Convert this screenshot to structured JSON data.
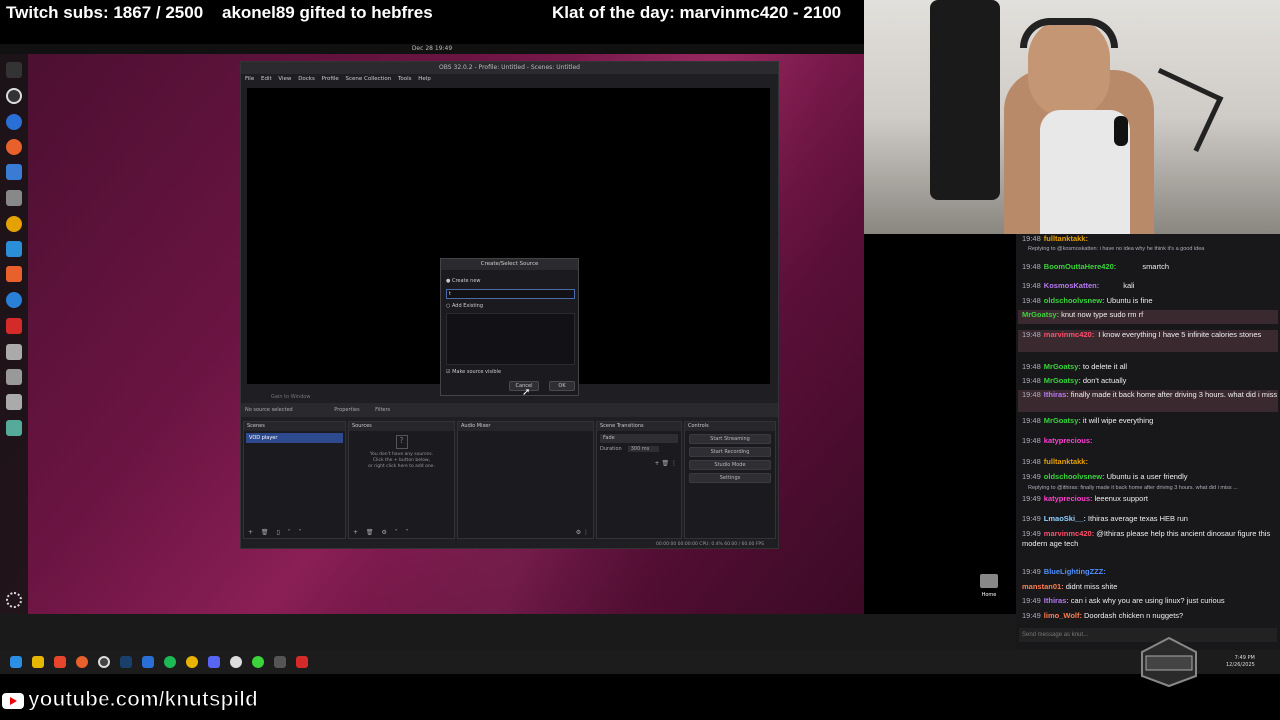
{
  "banner": {
    "subs": "Twitch subs: 1867 / 2500",
    "gift": "akonel89 gifted to hebfres",
    "klat": "Klat of the day: marvinmc420 - 2100"
  },
  "desktop": {
    "topbar_clock": "Dec 28  19:49",
    "home_label": "Home"
  },
  "obs": {
    "title": "OBS 32.0.2 - Profile: Untitled - Scenes: Untitled",
    "menu": [
      "File",
      "Edit",
      "View",
      "Docks",
      "Profile",
      "Scene Collection",
      "Tools",
      "Help"
    ],
    "no_source": "No source selected",
    "properties": "Properties",
    "filters": "Filters",
    "ctrl_strip": "Gain to Window",
    "docks": {
      "scenes": "Scenes",
      "sources": "Sources",
      "audio": "Audio Mixer",
      "transitions": "Scene Transitions",
      "controls": "Controls"
    },
    "scene_item": "VOD player",
    "no_sources_text": [
      "You don't have any sources.",
      "Click the + button below,",
      "or right click here to add one."
    ],
    "transition_value": "Fade",
    "duration_label": "Duration",
    "duration_value": "300 ms",
    "controls_buttons": [
      "Start Streaming",
      "Start Recording",
      "Studio Mode",
      "Settings"
    ],
    "status": "00:00:00     00:00:00     CPU: 0.4%    60.00 / 60.00 FPS"
  },
  "dialog": {
    "title": "Create/Select Source",
    "create_new": "Create new",
    "input_value": "t",
    "add_existing": "Add Existing",
    "make_visible": "Make source visible",
    "cancel": "Cancel",
    "ok": "OK"
  },
  "chat": {
    "messages": [
      {
        "time": "19:48",
        "user": "fulltanktakk:",
        "color": "#e5a100",
        "text": ""
      },
      {
        "time": "19:48",
        "user": "BoomOuttaHere420:",
        "color": "#3bd43b",
        "text": "smartch"
      },
      {
        "time": "19:48",
        "user": "KosmosKatten:",
        "color": "#b77bf0",
        "text": "kali"
      },
      {
        "time": "19:48",
        "user": "oldschoolvsnew:",
        "color": "#3bd43b",
        "text": "Ubuntu is fine"
      },
      {
        "time": "",
        "user": "MrGoatsy:",
        "color": "#3bd43b",
        "text": "knut now type sudo rm rf"
      },
      {
        "time": "19:48",
        "user": "marvinmc420:",
        "color": "#ff4f6a",
        "text": "I know everything I have 5 infinite calories stones"
      },
      {
        "time": "19:48",
        "user": "MrGoatsy:",
        "color": "#3bd43b",
        "text": "to delete it all"
      },
      {
        "time": "19:48",
        "user": "MrGoatsy:",
        "color": "#3bd43b",
        "text": "don't actually"
      },
      {
        "time": "19:48",
        "user": "Ithiras:",
        "color": "#b77bf0",
        "text": "finally made it back home after driving 3 hours. what did i miss"
      },
      {
        "time": "19:48",
        "user": "MrGoatsy:",
        "color": "#3bd43b",
        "text": "it will wipe everything"
      },
      {
        "time": "19:48",
        "user": "katyprecious:",
        "color": "#ff3fd0",
        "text": ""
      },
      {
        "time": "19:48",
        "user": "fulltanktakk:",
        "color": "#e5a100",
        "text": ""
      },
      {
        "time": "19:49",
        "user": "oldschoolvsnew:",
        "color": "#3bd43b",
        "text": "Ubuntu is a user friendly"
      },
      {
        "time": "19:49",
        "user": "katyprecious:",
        "color": "#ff3fd0",
        "text": "leeenux support"
      },
      {
        "time": "19:49",
        "user": "LmaoSki__:",
        "color": "#8fd0ff",
        "text": "Ithiras average texas HEB run"
      },
      {
        "time": "19:49",
        "user": "marvinmc420:",
        "color": "#ff4f6a",
        "text": "@Ithiras please help this ancient dinosaur figure this modern age tech"
      },
      {
        "time": "19:49",
        "user": "BlueLightingZZZ:",
        "color": "#4f8fff",
        "text": ""
      },
      {
        "time": "",
        "user": "manstan01:",
        "color": "#ff7f50",
        "text": "didnt miss shite"
      },
      {
        "time": "19:49",
        "user": "Ithiras:",
        "color": "#b77bf0",
        "text": "can i ask why you are using linux? just curious"
      },
      {
        "time": "19:49",
        "user": "limo_Wolf:",
        "color": "#ff7f50",
        "text": "Doordash chicken n nuggets?"
      }
    ],
    "reply1": "Replying to @kosmoskatten: i have no idea why he think it's a good idea",
    "reply2": "Replying to @ithiras: finally made it back home after driving 3 hours.  what did i miss ...",
    "input_placeholder": "Send message as knut..."
  },
  "taskbar": {
    "time": "7:49 PM",
    "date": "12/26/2025"
  },
  "youtube": {
    "url": "youtube.com/knutspild"
  }
}
